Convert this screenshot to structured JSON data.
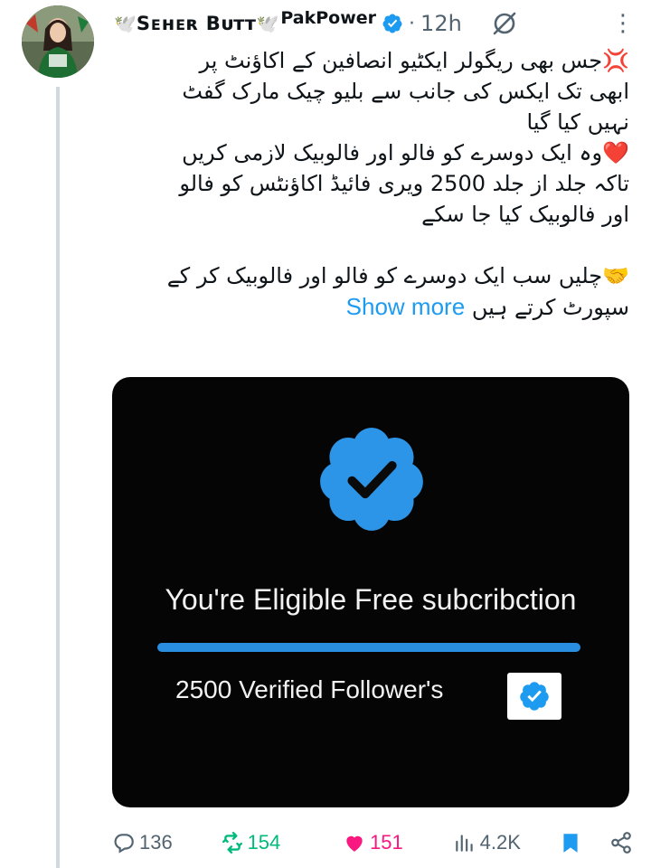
{
  "author": {
    "name": "Seher Butt",
    "name_display": "Sᴇʜᴇʀ Bᴜᴛᴛ",
    "handle_prefix": "🕊️",
    "handle": "PakPower",
    "time": "12h",
    "verified": true
  },
  "tweet": {
    "lines": [
      "💢جس بھی ریگولر ایکٹیو انصافین کے اکاؤنٹ پر",
      "ابھی تک ایکس کی جانب سے بلیو چیک مارک گفٹ",
      "نہیں کیا گیا",
      "❤️وہ ایک دوسرے کو فالو اور فالوبیک لازمی کریں",
      "تاکہ جلد از جلد 2500 ویری فائیڈ اکاؤنٹس کو فالو",
      "اور فالوبیک کیا جا سکے",
      "🤝چلیں سب ایک دوسرے کو فالو اور فالوبیک کر کے"
    ],
    "last_line": "سپورٹ کرتے ہیں",
    "show_more": "Show more"
  },
  "media": {
    "eligible_text": "You're Eligible Free subcribction",
    "followers_text": "2500 Verified Follower's"
  },
  "actions": {
    "replies": "136",
    "reposts": "154",
    "likes": "151",
    "views": "4.2K"
  },
  "colors": {
    "accent": "#1d9bf0",
    "repost": "#00ba7c",
    "like": "#f91880",
    "muted": "#536471"
  }
}
